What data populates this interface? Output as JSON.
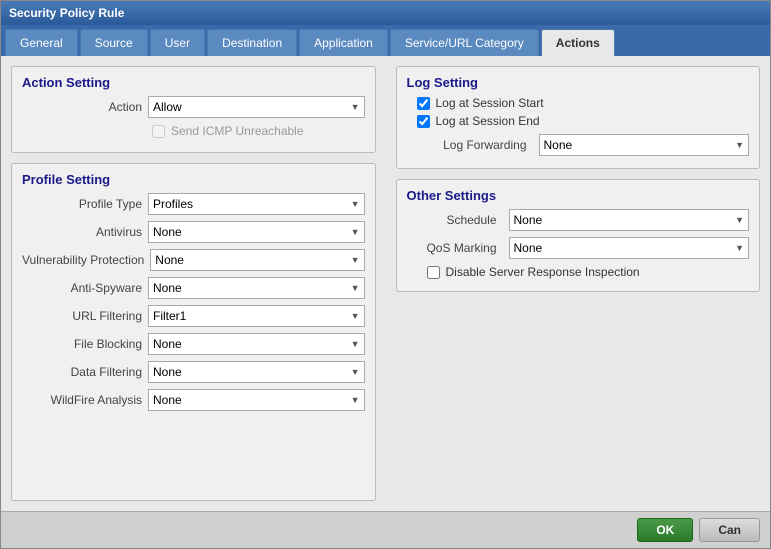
{
  "dialog": {
    "title": "Security Policy Rule"
  },
  "tabs": [
    {
      "id": "general",
      "label": "General"
    },
    {
      "id": "source",
      "label": "Source"
    },
    {
      "id": "user",
      "label": "User"
    },
    {
      "id": "destination",
      "label": "Destination"
    },
    {
      "id": "application",
      "label": "Application"
    },
    {
      "id": "service_url",
      "label": "Service/URL Category"
    },
    {
      "id": "actions",
      "label": "Actions"
    }
  ],
  "active_tab": "actions",
  "action_setting": {
    "section_title": "Action Setting",
    "action_label": "Action",
    "action_value": "Allow",
    "send_icmp_label": "Send ICMP Unreachable",
    "send_icmp_checked": false,
    "send_icmp_disabled": true
  },
  "profile_setting": {
    "section_title": "Profile Setting",
    "profile_type_label": "Profile Type",
    "profile_type_value": "Profiles",
    "antivirus_label": "Antivirus",
    "antivirus_value": "None",
    "vuln_label": "Vulnerability Protection",
    "vuln_value": "None",
    "anti_spyware_label": "Anti-Spyware",
    "anti_spyware_value": "None",
    "url_filtering_label": "URL Filtering",
    "url_filtering_value": "Filter1",
    "file_blocking_label": "File Blocking",
    "file_blocking_value": "None",
    "data_filtering_label": "Data Filtering",
    "data_filtering_value": "None",
    "wildfire_label": "WildFire Analysis",
    "wildfire_value": "None"
  },
  "log_setting": {
    "section_title": "Log Setting",
    "log_session_start_label": "Log at Session Start",
    "log_session_start_checked": true,
    "log_session_end_label": "Log at Session End",
    "log_session_end_checked": true,
    "log_forwarding_label": "Log Forwarding",
    "log_forwarding_value": "None"
  },
  "other_settings": {
    "section_title": "Other Settings",
    "schedule_label": "Schedule",
    "schedule_value": "None",
    "qos_label": "QoS Marking",
    "qos_value": "None",
    "disable_server_label": "Disable Server Response Inspection",
    "disable_server_checked": false
  },
  "footer": {
    "ok_label": "OK",
    "cancel_label": "Can"
  }
}
